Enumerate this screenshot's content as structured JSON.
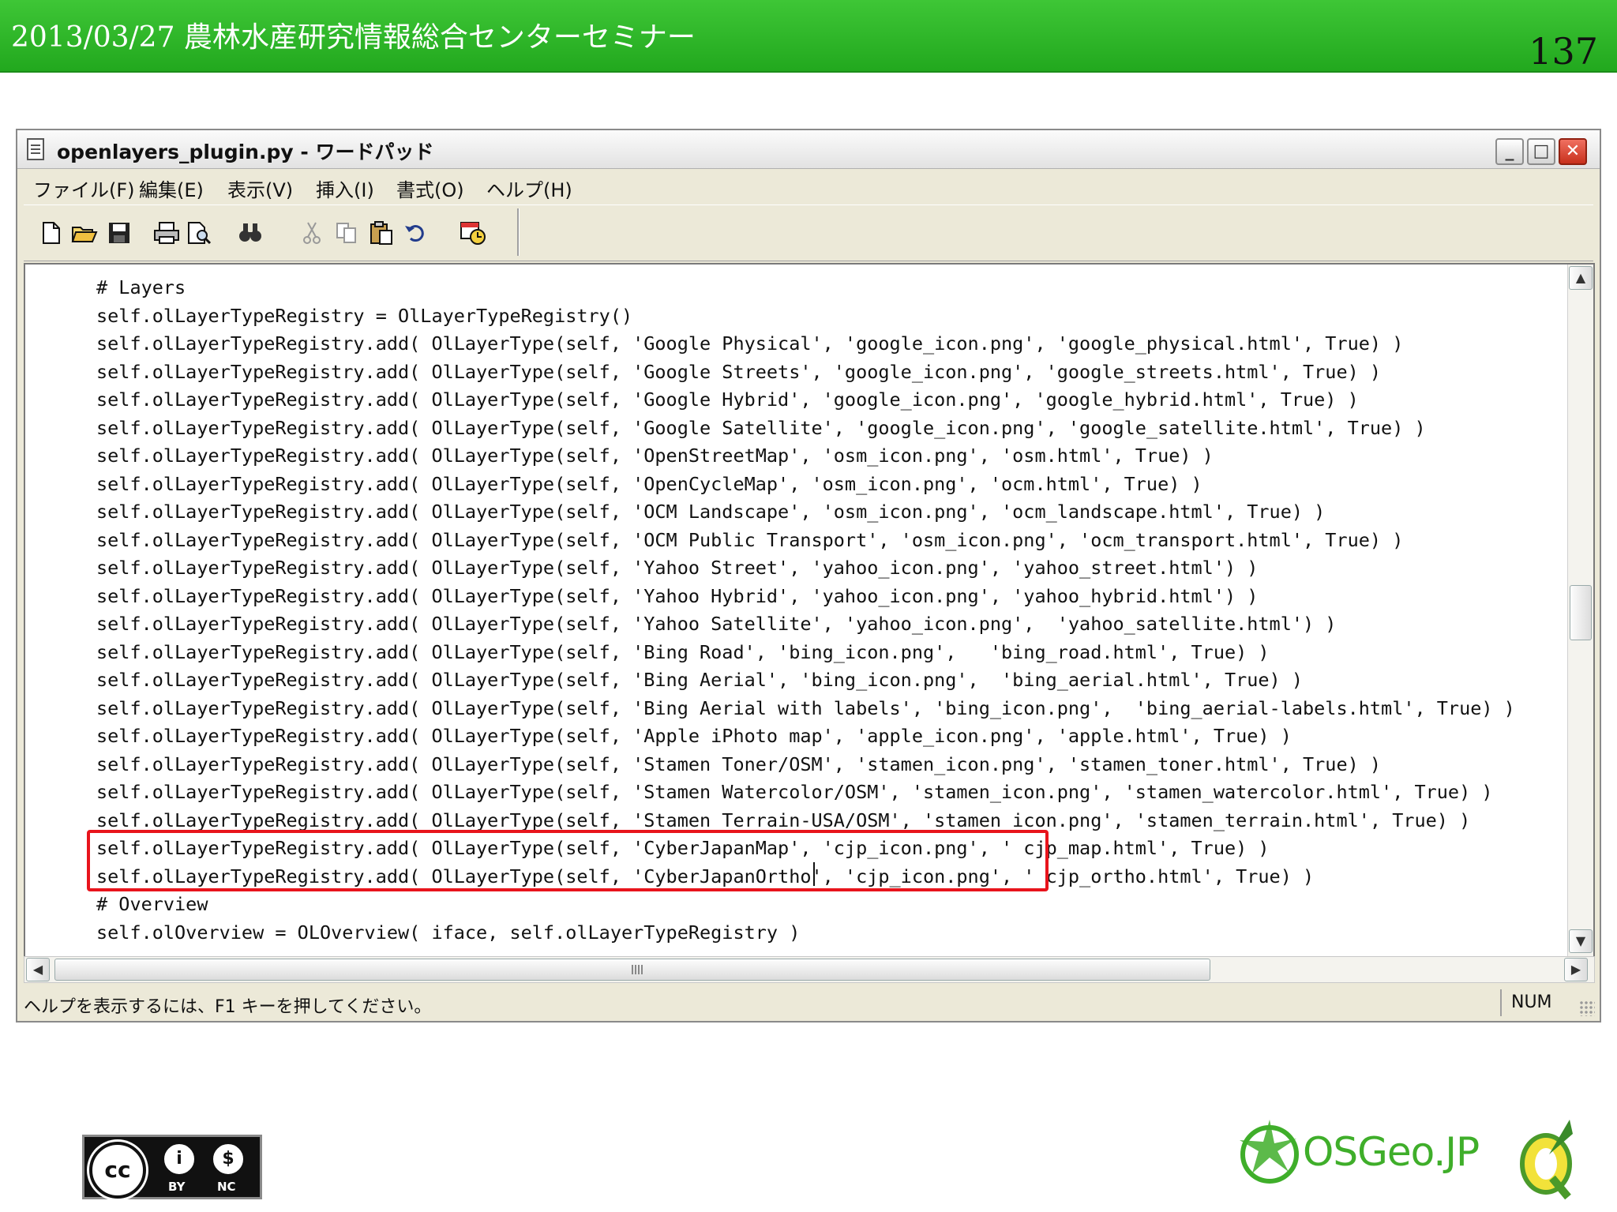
{
  "slide": {
    "title": "2013/03/27 農林水産研究情報総合センターセミナー",
    "page_number": "137"
  },
  "window": {
    "title": "openlayers_plugin.py - ワードパッド",
    "controls": {
      "minimize": "_",
      "maximize": "□",
      "close": "✕"
    }
  },
  "menu": {
    "items": [
      "ファイル(F)",
      "編集(E)",
      "表示(V)",
      "挿入(I)",
      "書式(O)",
      "ヘルプ(H)"
    ]
  },
  "toolbar": {
    "buttons": [
      "new-document-icon",
      "open-folder-icon",
      "save-icon",
      "print-icon",
      "print-preview-icon",
      "find-icon",
      "cut-icon",
      "copy-icon",
      "paste-icon",
      "undo-icon",
      "insert-datetime-icon"
    ]
  },
  "code": {
    "lines": [
      "# Layers",
      "self.olLayerTypeRegistry = OlLayerTypeRegistry()",
      "self.olLayerTypeRegistry.add( OlLayerType(self, 'Google Physical', 'google_icon.png', 'google_physical.html', True) )",
      "self.olLayerTypeRegistry.add( OlLayerType(self, 'Google Streets', 'google_icon.png', 'google_streets.html', True) )",
      "self.olLayerTypeRegistry.add( OlLayerType(self, 'Google Hybrid', 'google_icon.png', 'google_hybrid.html', True) )",
      "self.olLayerTypeRegistry.add( OlLayerType(self, 'Google Satellite', 'google_icon.png', 'google_satellite.html', True) )",
      "self.olLayerTypeRegistry.add( OlLayerType(self, 'OpenStreetMap', 'osm_icon.png', 'osm.html', True) )",
      "self.olLayerTypeRegistry.add( OlLayerType(self, 'OpenCycleMap', 'osm_icon.png', 'ocm.html', True) )",
      "self.olLayerTypeRegistry.add( OlLayerType(self, 'OCM Landscape', 'osm_icon.png', 'ocm_landscape.html', True) )",
      "self.olLayerTypeRegistry.add( OlLayerType(self, 'OCM Public Transport', 'osm_icon.png', 'ocm_transport.html', True) )",
      "self.olLayerTypeRegistry.add( OlLayerType(self, 'Yahoo Street', 'yahoo_icon.png', 'yahoo_street.html') )",
      "self.olLayerTypeRegistry.add( OlLayerType(self, 'Yahoo Hybrid', 'yahoo_icon.png', 'yahoo_hybrid.html') )",
      "self.olLayerTypeRegistry.add( OlLayerType(self, 'Yahoo Satellite', 'yahoo_icon.png',  'yahoo_satellite.html') )",
      "self.olLayerTypeRegistry.add( OlLayerType(self, 'Bing Road', 'bing_icon.png',   'bing_road.html', True) )",
      "self.olLayerTypeRegistry.add( OlLayerType(self, 'Bing Aerial', 'bing_icon.png',  'bing_aerial.html', True) )",
      "self.olLayerTypeRegistry.add( OlLayerType(self, 'Bing Aerial with labels', 'bing_icon.png',  'bing_aerial-labels.html', True) )",
      "self.olLayerTypeRegistry.add( OlLayerType(self, 'Apple iPhoto map', 'apple_icon.png', 'apple.html', True) )",
      "self.olLayerTypeRegistry.add( OlLayerType(self, 'Stamen Toner/OSM', 'stamen_icon.png', 'stamen_toner.html', True) )",
      "self.olLayerTypeRegistry.add( OlLayerType(self, 'Stamen Watercolor/OSM', 'stamen_icon.png', 'stamen_watercolor.html', True) )",
      "self.olLayerTypeRegistry.add( OlLayerType(self, 'Stamen Terrain-USA/OSM', 'stamen_icon.png', 'stamen_terrain.html', True) )",
      "self.olLayerTypeRegistry.add( OlLayerType(self, 'CyberJapanMap', 'cjp_icon.png', ' cjp_map.html', True) )",
      "self.olLayerTypeRegistry.add( OlLayerType(self, 'CyberJapanOrtho', 'cjp_icon.png', ' cjp_ortho.html', True) )",
      "# Overview",
      "self.olOverview = OLOverview( iface, self.olLayerTypeRegistry )"
    ]
  },
  "statusbar": {
    "help_text": "ヘルプを表示するには、F1 キーを押してください。",
    "num_indicator": "NUM"
  },
  "footer": {
    "cc_by": "BY",
    "cc_nc": "NC",
    "osgeo_text": "OSGeo.JP"
  },
  "colors": {
    "header_green": "#22a81e",
    "highlight_red": "#e8141c",
    "osgeo_green": "#3fae2a"
  }
}
